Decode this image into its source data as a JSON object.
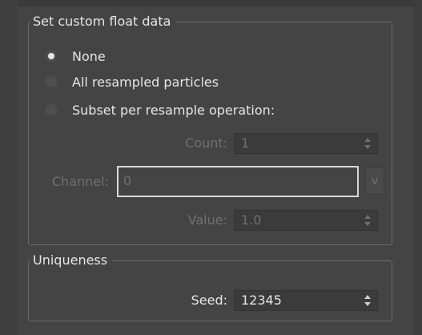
{
  "custom_float_group": {
    "title": "Set custom float data",
    "options": [
      {
        "label": "None",
        "checked": true
      },
      {
        "label": "All resampled particles",
        "checked": false
      },
      {
        "label": "Subset per resample operation:",
        "checked": false
      }
    ],
    "count": {
      "label": "Count:",
      "value": "1"
    },
    "channel": {
      "label": "Channel:",
      "value": "0",
      "button_label": "v"
    },
    "value": {
      "label": "Value:",
      "value": "1.0"
    }
  },
  "uniqueness_group": {
    "title": "Uniqueness",
    "seed": {
      "label": "Seed:",
      "value": "12345"
    }
  }
}
